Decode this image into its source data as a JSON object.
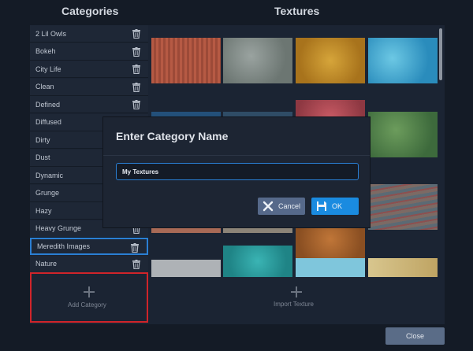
{
  "headers": {
    "categories": "Categories",
    "textures": "Textures"
  },
  "categories": [
    {
      "label": "2 Lil Owls"
    },
    {
      "label": "Bokeh"
    },
    {
      "label": "City Life"
    },
    {
      "label": "Clean"
    },
    {
      "label": "Defined"
    },
    {
      "label": "Diffused"
    },
    {
      "label": "Dirty"
    },
    {
      "label": "Dust"
    },
    {
      "label": "Dynamic"
    },
    {
      "label": "Grunge"
    },
    {
      "label": "Hazy"
    },
    {
      "label": "Heavy Grunge"
    },
    {
      "label": "Meredith Images",
      "selected": true
    },
    {
      "label": "Nature"
    }
  ],
  "add_category_label": "Add Category",
  "import_texture_label": "Import Texture",
  "close_label": "Close",
  "dialog": {
    "title": "Enter Category Name",
    "input_value": "My Textures",
    "cancel_label": "Cancel",
    "ok_label": "OK"
  },
  "colors": {
    "accent": "#1a8be0",
    "highlight_border": "#d0242a"
  }
}
